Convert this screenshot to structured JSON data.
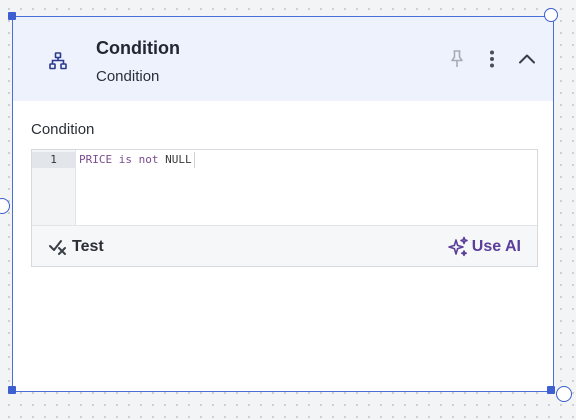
{
  "node": {
    "title": "Condition",
    "subtitle": "Condition",
    "icons": {
      "node_icon": "hierarchy-icon",
      "pin": "pin-icon",
      "menu": "more-vertical-icon",
      "collapse": "chevron-up-icon"
    }
  },
  "condition_field": {
    "label": "Condition",
    "line_numbers": [
      "1"
    ],
    "code": {
      "token1": "PRICE",
      "token2": "is not",
      "token3": "NULL"
    }
  },
  "editor_footer": {
    "test_label": "Test",
    "test_icon": "check-x-icon",
    "ai_label": "Use AI",
    "ai_icon": "sparkles-icon"
  },
  "colors": {
    "accent": "#3d5fcf",
    "header_bg": "#eef2fd",
    "ai_purple": "#5b3f9a"
  }
}
